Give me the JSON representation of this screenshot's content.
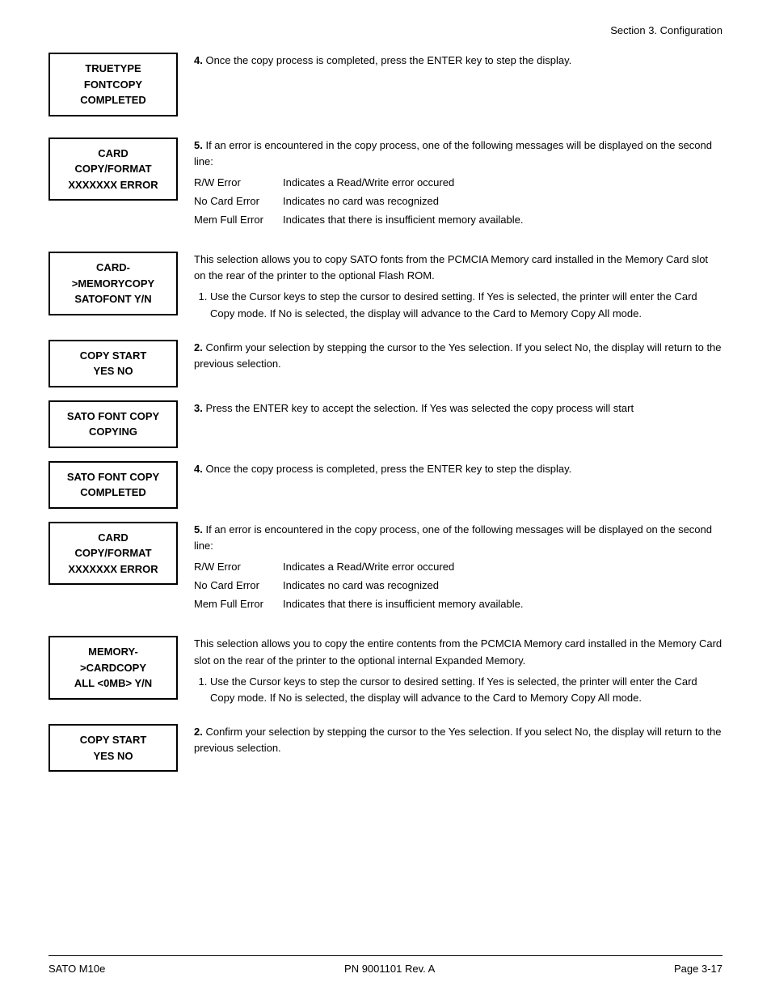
{
  "header": {
    "section": "Section 3. Configuration"
  },
  "footer": {
    "left": "SATO M10e",
    "center": "PN 9001101 Rev. A",
    "right": "Page 3-17"
  },
  "blocks": [
    {
      "id": "truetype-completed",
      "lcd_lines": [
        "TRUETYPE",
        "FONTCOPY",
        "COMPLETED"
      ],
      "step_number": "4.",
      "description": "Once the copy process is completed, press the ENTER key to step the display.",
      "type": "simple"
    },
    {
      "id": "card-copy-format-error-1",
      "lcd_lines": [
        "CARD COPY/FORMAT",
        "XXXXXXX ERROR"
      ],
      "step_number": "5.",
      "description": "If an error is encountered in the copy process, one of the following messages will be displayed on the second line:",
      "errors": [
        {
          "code": "R/W Error",
          "desc": "Indicates a Read/Write error occured"
        },
        {
          "code": "No Card Error",
          "desc": "Indicates no card was recognized"
        },
        {
          "code": "Mem Full Error",
          "desc": "Indicates that there is insufficient memory available."
        }
      ],
      "type": "error"
    },
    {
      "id": "card-memorycopy-satofont",
      "lcd_lines": [
        "CARD->MEMORYCOPY",
        "SATOFONT      Y/N"
      ],
      "description": "This selection allows you to copy SATO fonts from the PCMCIA Memory card installed in the Memory Card slot on the rear of the printer to the optional Flash ROM.",
      "steps": [
        "Use the Cursor keys to step the cursor to desired setting. If Yes is selected, the printer will enter the Card Copy mode. If No is selected, the display will advance to the Card to Memory Copy All mode."
      ],
      "type": "intro-steps"
    },
    {
      "id": "copy-start-yes-no-1",
      "lcd_lines": [
        "COPY START",
        "  YES       NO"
      ],
      "step_number": "2.",
      "description": "Confirm your selection by stepping the cursor to the Yes selection. If you select No, the display will return to the previous selection.",
      "type": "simple"
    },
    {
      "id": "sato-font-copy-copying",
      "lcd_lines": [
        "SATO FONT COPY",
        "COPYING"
      ],
      "step_number": "3.",
      "description": "Press the ENTER key to accept the selection. If Yes was selected the copy process will start",
      "type": "simple"
    },
    {
      "id": "sato-font-copy-completed",
      "lcd_lines": [
        "SATO FONT COPY",
        "COMPLETED"
      ],
      "step_number": "4.",
      "description": "Once the copy process is completed, press the ENTER key to step the display.",
      "type": "simple"
    },
    {
      "id": "card-copy-format-error-2",
      "lcd_lines": [
        "CARD COPY/FORMAT",
        "XXXXXXX ERROR"
      ],
      "step_number": "5.",
      "description": "If an error is encountered in the copy process, one of the following messages will be displayed on the second line:",
      "errors": [
        {
          "code": "R/W Error",
          "desc": "Indicates a Read/Write error occured"
        },
        {
          "code": "No Card Error",
          "desc": "Indicates no card was recognized"
        },
        {
          "code": "Mem Full Error",
          "desc": "Indicates that there is insufficient memory available."
        }
      ],
      "type": "error"
    },
    {
      "id": "memory-cardcopy-all",
      "lcd_lines": [
        "MEMORY->CARDCOPY",
        "ALL    <0MB>   Y/N"
      ],
      "description": "This selection allows you to copy the entire contents from the PCMCIA Memory card installed in the Memory Card slot on the rear of the printer to the optional internal Expanded Memory.",
      "steps": [
        "Use the Cursor keys to step the cursor to desired setting. If Yes is selected, the printer will enter the Card Copy mode. If No is selected, the display will advance to the Card to Memory Copy All mode."
      ],
      "type": "intro-steps"
    },
    {
      "id": "copy-start-yes-no-2",
      "lcd_lines": [
        "COPY START",
        "  YES       NO"
      ],
      "step_number": "2.",
      "description": "Confirm your selection by stepping the cursor to the Yes selection. If you select No, the display will return to the previous selection.",
      "type": "simple"
    }
  ]
}
